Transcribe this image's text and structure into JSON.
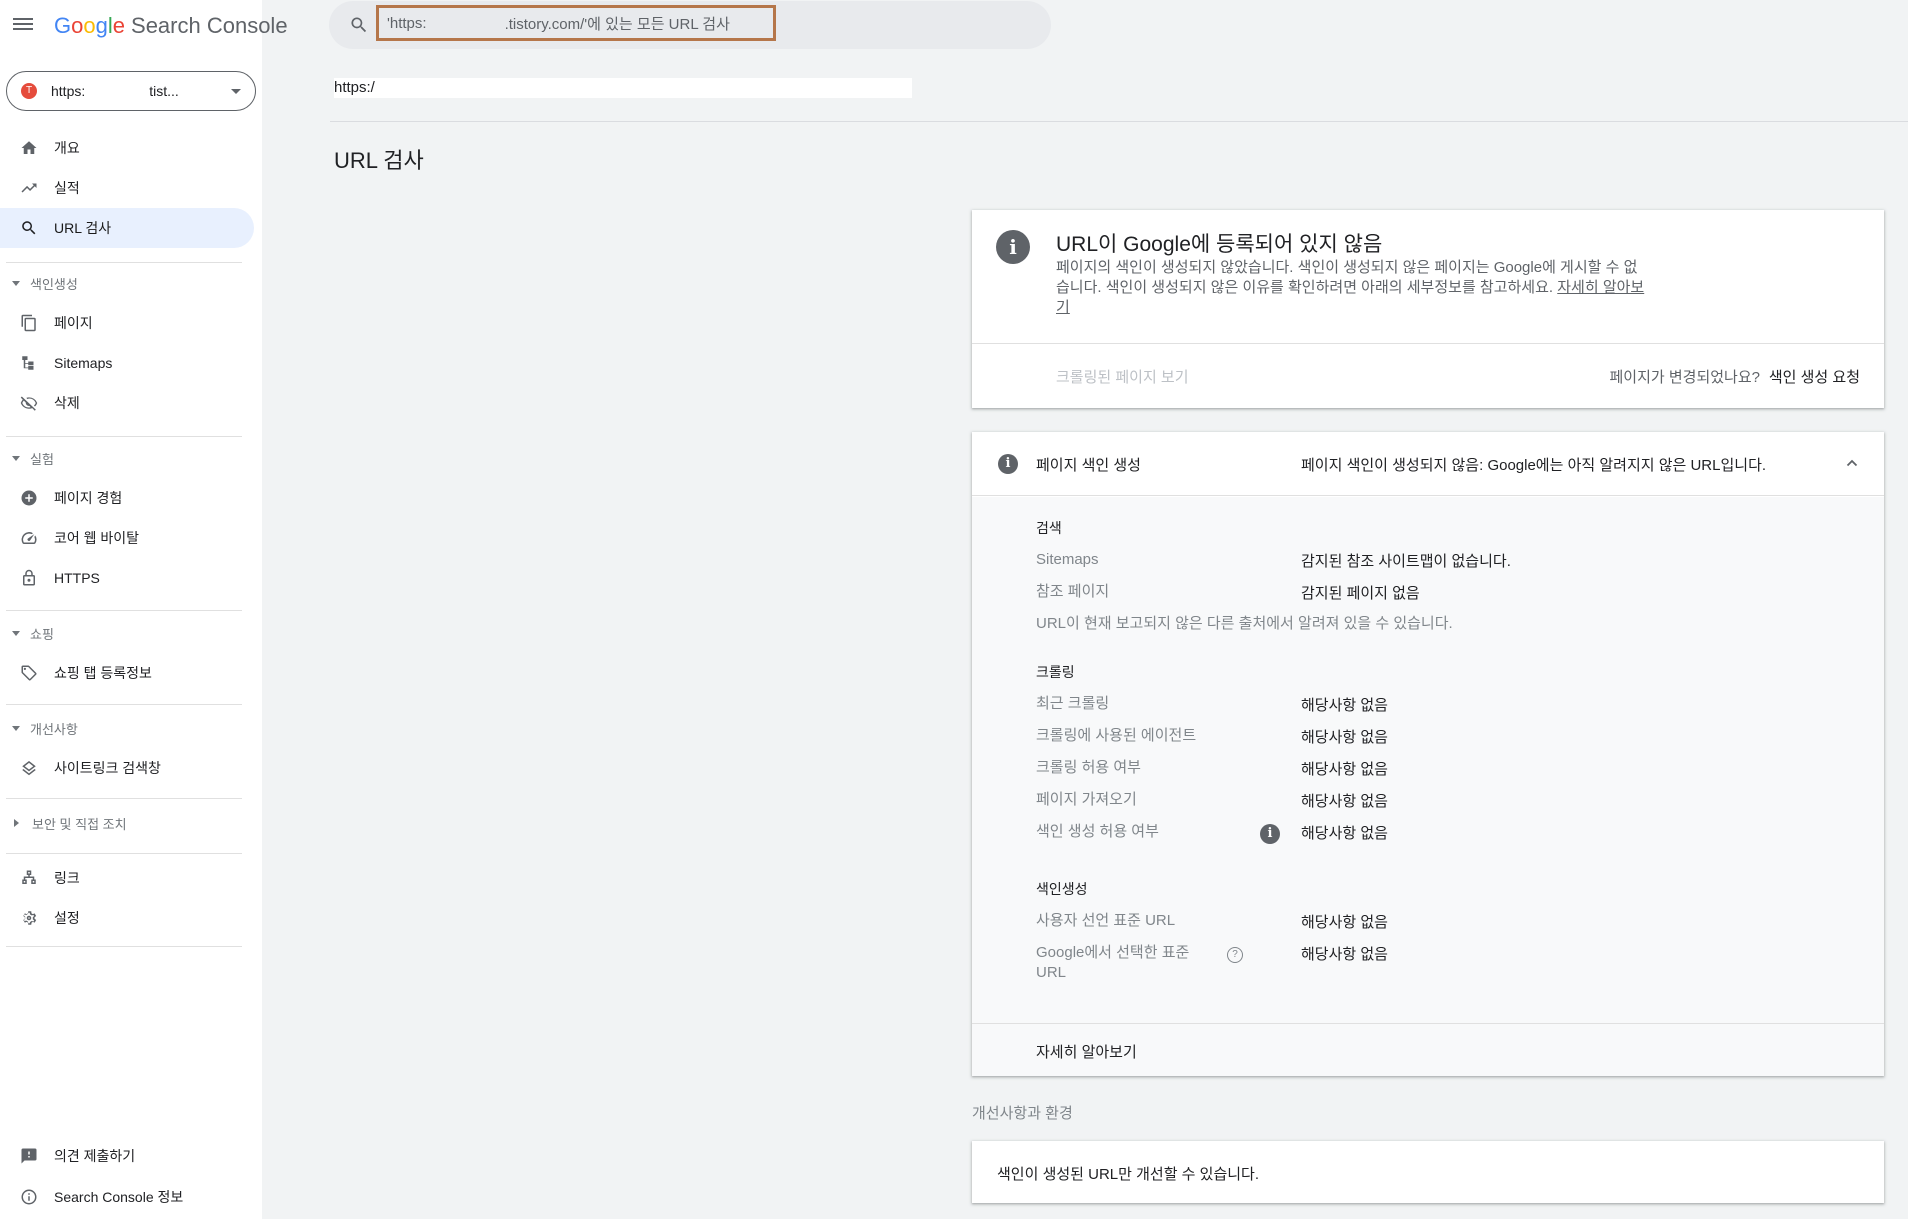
{
  "app": {
    "logo_letters": [
      "G",
      "o",
      "o",
      "g",
      "l",
      "e"
    ],
    "product": "Search Console"
  },
  "property": {
    "favicon_letter": "T",
    "text_start": "https:",
    "text_end": "tist..."
  },
  "search": {
    "value_start": "'https:",
    "value_end": ".tistory.com/'에 있는 모든 URL 검사"
  },
  "url_field": "https:/",
  "sidebar": {
    "main": [
      {
        "label": "개요",
        "icon": "home-icon"
      },
      {
        "label": "실적",
        "icon": "trending-up-icon"
      },
      {
        "label": "URL 검사",
        "icon": "search-icon"
      }
    ],
    "sections": {
      "indexing": "색인생성",
      "experience": "실험",
      "shopping": "쇼핑",
      "enhancements": "개선사항",
      "security": "보안 및 직접 조치"
    },
    "indexing_items": [
      {
        "label": "페이지",
        "icon": "pages-icon"
      },
      {
        "label": "Sitemaps",
        "icon": "sitemap-icon"
      },
      {
        "label": "삭제",
        "icon": "visibility-off-icon"
      }
    ],
    "experience_items": [
      {
        "label": "페이지 경험",
        "icon": "add-circle-icon"
      },
      {
        "label": "코어 웹 바이탈",
        "icon": "speed-icon"
      },
      {
        "label": "HTTPS",
        "icon": "lock-icon"
      }
    ],
    "shopping_items": [
      {
        "label": "쇼핑 탭 등록정보",
        "icon": "tag-icon"
      }
    ],
    "enhancement_items": [
      {
        "label": "사이트링크 검색창",
        "icon": "layers-icon"
      }
    ],
    "other_items": [
      {
        "label": "링크",
        "icon": "links-icon"
      },
      {
        "label": "설정",
        "icon": "settings-icon"
      }
    ],
    "bottom_items": [
      {
        "label": "의견 제출하기",
        "icon": "feedback-icon"
      },
      {
        "label": "Search Console 정보",
        "icon": "info-icon"
      }
    ]
  },
  "page_title": "URL 검사",
  "status_card": {
    "title": "URL이 Google에 등록되어 있지 않음",
    "description": "페이지의 색인이 생성되지 않았습니다. 색인이 생성되지 않은 페이지는 Google에 게시할 수 없습니다. 색인이 생성되지 않은 이유를 확인하려면 아래의 세부정보를 참고하세요.",
    "learn_more": "자세히 알아보기",
    "view_crawled": "크롤링된 페이지 보기",
    "changed_question": "페이지가 변경되었나요?",
    "request_indexing": "색인 생성 요청"
  },
  "indexing_card": {
    "label": "페이지 색인 생성",
    "status": "페이지 색인이 생성되지 않음: Google에는 아직 알려지지 않은 URL입니다.",
    "sections": {
      "discovery": "검색",
      "crawl": "크롤링",
      "indexing": "색인생성"
    },
    "discovery_rows": [
      {
        "label": "Sitemaps",
        "value": "감지된 참조 사이트맵이 없습니다."
      },
      {
        "label": "참조 페이지",
        "value": "감지된 페이지 없음"
      }
    ],
    "discovery_note": "URL이 현재 보고되지 않은 다른 출처에서 알려져 있을 수 있습니다.",
    "crawl_rows": [
      {
        "label": "최근 크롤링",
        "value": "해당사항 없음"
      },
      {
        "label": "크롤링에 사용된 에이전트",
        "value": "해당사항 없음"
      },
      {
        "label": "크롤링 허용 여부",
        "value": "해당사항 없음"
      },
      {
        "label": "페이지 가져오기",
        "value": "해당사항 없음"
      },
      {
        "label": "색인 생성 허용 여부",
        "value": "해당사항 없음"
      }
    ],
    "index_rows": [
      {
        "label": "사용자 선언 표준 URL",
        "value": "해당사항 없음"
      },
      {
        "label": "Google에서 선택한 표준 URL",
        "value": "해당사항 없음"
      }
    ],
    "footer_link": "자세히 알아보기"
  },
  "enhancements": {
    "title": "개선사항과 환경",
    "message": "색인이 생성된 URL만 개선할 수 있습니다."
  },
  "colors": {
    "accent_active": "#e8f0fe",
    "search_highlight": "#b5764a",
    "background": "#f1f3f4"
  }
}
